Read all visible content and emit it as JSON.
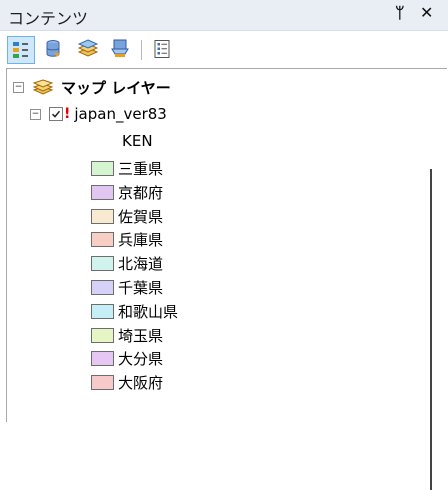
{
  "window": {
    "title": "コンテンツ",
    "pin_glyph": "ᛘ",
    "close_glyph": "✕"
  },
  "toolbar": {
    "buttons": [
      {
        "name": "list-by-drawing-order",
        "icon": "drawing-order-icon",
        "selected": true
      },
      {
        "name": "list-by-source",
        "icon": "database-icon",
        "selected": false
      },
      {
        "name": "list-by-visibility",
        "icon": "layers-icon",
        "selected": false
      },
      {
        "name": "list-by-selection",
        "icon": "selection-icon",
        "selected": false
      },
      {
        "name": "options",
        "icon": "options-list-icon",
        "selected": false
      }
    ]
  },
  "tree": {
    "map_node": {
      "label": "マップ レイヤー",
      "expander": "⊟"
    },
    "layer": {
      "label": "japan_ver83",
      "expander": "⊟",
      "checked": true,
      "warning": "!"
    },
    "field": {
      "label": "KEN"
    },
    "categories": [
      {
        "label": "三重県",
        "color": "#d4f5d0"
      },
      {
        "label": "京都府",
        "color": "#e0c6f0"
      },
      {
        "label": "佐賀県",
        "color": "#f7ead0"
      },
      {
        "label": "兵庫県",
        "color": "#f6cec4"
      },
      {
        "label": "北海道",
        "color": "#d1f3ee"
      },
      {
        "label": "千葉県",
        "color": "#d4d2f6"
      },
      {
        "label": "和歌山県",
        "color": "#c6eef7"
      },
      {
        "label": "埼玉県",
        "color": "#e6f5c4"
      },
      {
        "label": "大分県",
        "color": "#e6c6f3"
      },
      {
        "label": "大阪府",
        "color": "#f7c9c9"
      }
    ]
  }
}
